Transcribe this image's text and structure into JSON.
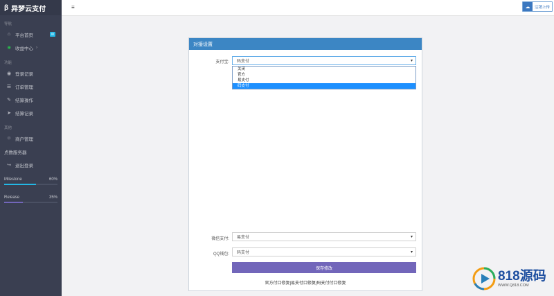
{
  "brand": {
    "logo_glyph": "β",
    "title": "异梦云支付"
  },
  "sidebar": {
    "section1_title": "导航",
    "section1_items": [
      {
        "label": "平台首页",
        "icon": "home-icon",
        "glyph": "⌂",
        "badge": "✉"
      },
      {
        "label": "收益中心",
        "icon": "leaf-icon",
        "glyph": "❀",
        "caret": "›"
      }
    ],
    "section2_title": "功能",
    "section2_items": [
      {
        "label": "登录记录",
        "icon": "camera-icon",
        "glyph": "◉"
      },
      {
        "label": "订单管理",
        "icon": "cart-icon",
        "glyph": "☰"
      },
      {
        "label": "结算操作",
        "icon": "edit-icon",
        "glyph": "✎"
      },
      {
        "label": "结算记录",
        "icon": "send-icon",
        "glyph": "➤"
      }
    ],
    "section3_title": "其他",
    "section3_items": [
      {
        "label": "商户管理",
        "icon": "user-icon",
        "glyph": "☺"
      }
    ],
    "plain_item": "点数服务器",
    "logout": {
      "label": "退出登录",
      "icon": "logout-icon",
      "glyph": "↪"
    },
    "progress": [
      {
        "label": "Milestone",
        "value": "60%",
        "fraction": 0.6,
        "color": "#23b7e5"
      },
      {
        "label": "Release",
        "value": "35%",
        "fraction": 0.35,
        "color": "#7266ba"
      }
    ]
  },
  "topbar": {
    "menu_glyph": "≡",
    "button_label": "注销上传",
    "cloud_glyph": "☁"
  },
  "panel": {
    "title": "对接设置",
    "fields": [
      {
        "label": "支付宝:",
        "value": "码支付"
      },
      {
        "label": "微信支付:",
        "value": "易支付"
      },
      {
        "label": "QQ钱包:",
        "value": "码支付"
      }
    ],
    "dropdown_options": [
      "关闭",
      "官方",
      "易支付",
      "码支付"
    ],
    "dropdown_selected": 3,
    "chev_glyph": "▾",
    "save_label": "保存修改",
    "footnote": "官方付口修复|易支付口修复|码支付付口修复"
  },
  "watermark": {
    "big": "818源码",
    "small": "WWW.Q818.COM"
  }
}
